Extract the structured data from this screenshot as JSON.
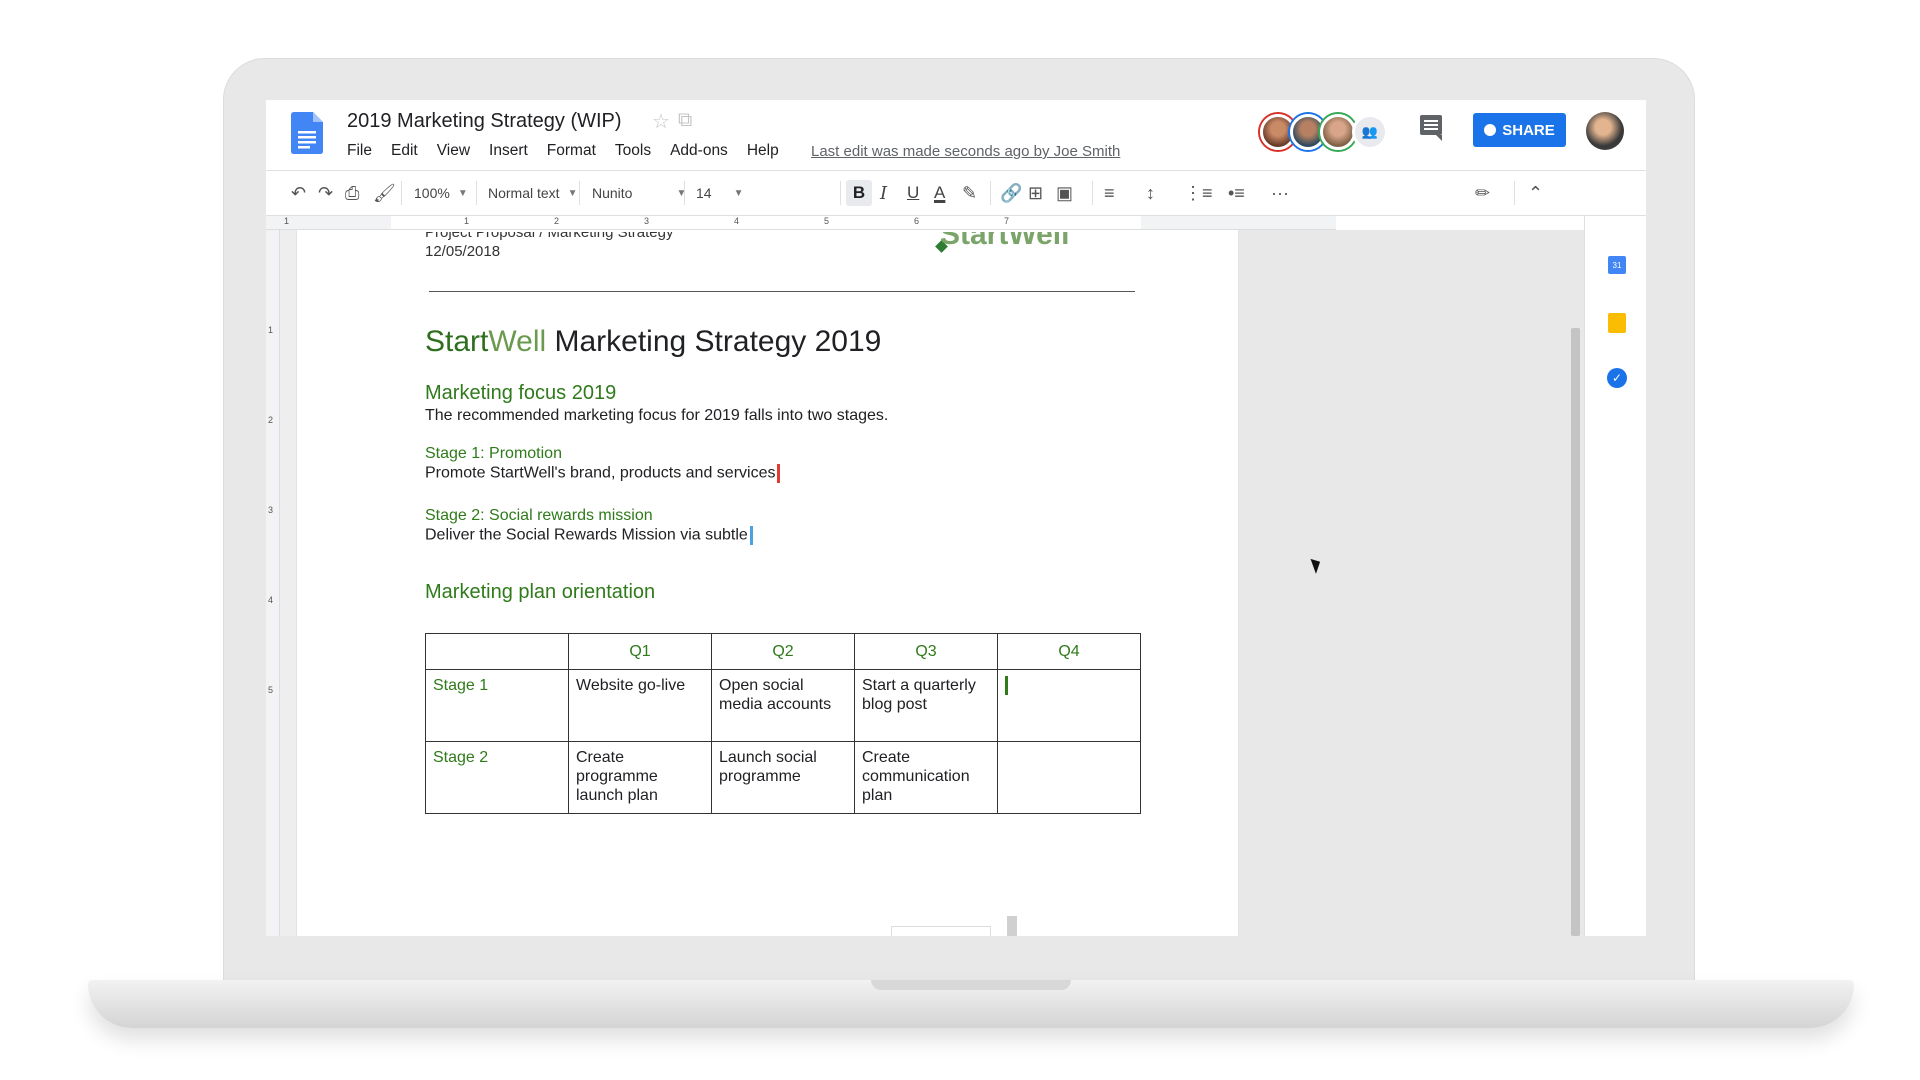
{
  "document": {
    "title": "2019 Marketing Strategy (WIP)",
    "last_edit": "Last edit was made seconds ago by Joe Smith"
  },
  "menu": [
    "File",
    "Edit",
    "View",
    "Insert",
    "Format",
    "Tools",
    "Add-ons",
    "Help"
  ],
  "header_actions": {
    "share_label": "SHARE"
  },
  "toolbar": {
    "zoom": "100%",
    "style": "Normal text",
    "font": "Nunito",
    "font_size": "14",
    "bold": "B",
    "italic": "I",
    "underline": "U",
    "text_color": "A",
    "more": "···"
  },
  "ruler": {
    "h_marks": [
      "1",
      "1",
      "2",
      "3",
      "4",
      "5",
      "6",
      "7"
    ],
    "v_marks": [
      "1",
      "2",
      "3",
      "4",
      "5"
    ]
  },
  "page": {
    "header_line": "Project Proposal / Marketing Strategy",
    "header_date": "12/05/2018",
    "header_logo": "StartWell",
    "heading_brand_a": "Start",
    "heading_brand_b": "Well",
    "heading_rest": " Marketing Strategy 2019",
    "section1_title": "Marketing focus 2019",
    "section1_body": "The recommended marketing focus for 2019 falls into two stages.",
    "stage1_title": "Stage 1: Promotion",
    "stage1_body": "Promote StartWell's brand, products and services",
    "stage2_title": "Stage 2: Social rewards mission",
    "stage2_body": "Deliver the Social Rewards Mission via subtle",
    "section2_title": "Marketing plan orientation",
    "table": {
      "headers": [
        "",
        "Q1",
        "Q2",
        "Q3",
        "Q4"
      ],
      "rows": [
        [
          "Stage 1",
          "Website go-live",
          "Open social media accounts",
          "Start a quarterly blog post",
          ""
        ],
        [
          "Stage 2",
          "Create programme launch plan",
          "Launch social programme",
          "Create communication plan",
          ""
        ]
      ]
    }
  },
  "side_panel": {
    "calendar_label": "31"
  },
  "colors": {
    "brand_green": "#2f7a1a",
    "share_blue": "#1a73e8"
  }
}
